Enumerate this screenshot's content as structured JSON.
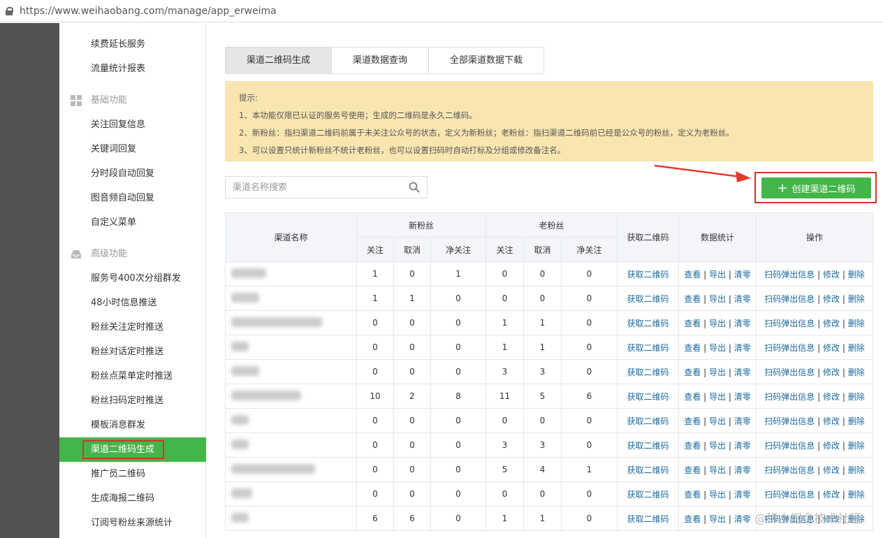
{
  "url": "https://www.weihaobang.com/manage/app_erweima",
  "sidebar": {
    "top_items": [
      "续费延长服务",
      "流量统计报表"
    ],
    "section_basic": "基础功能",
    "basic_items": [
      "关注回复信息",
      "关键词回复",
      "分时段自动回复",
      "图音频自动回复",
      "自定义菜单"
    ],
    "section_advanced": "高级功能",
    "advanced_items": [
      "服务号400次分组群发",
      "48小时信息推送",
      "粉丝关注定时推送",
      "粉丝对话定时推送",
      "粉丝点菜单定时推送",
      "粉丝扫码定时推送",
      "模板消息群发",
      "渠道二维码生成",
      "推广员二维码",
      "生成海报二维码",
      "订阅号粉丝来源统计"
    ],
    "active": "渠道二维码生成"
  },
  "tabs": [
    "渠道二维码生成",
    "渠道数据查询",
    "全部渠道数据下载"
  ],
  "notice": {
    "title": "提示:",
    "lines": [
      "1、本功能仅限已认证的服务号使用；生成的二维码是永久二维码。",
      "2、新粉丝：指扫渠道二维码前属于未关注公众号的状态，定义为新粉丝；老粉丝：指扫渠道二维码前已经是公众号的粉丝，定义为老粉丝。",
      "3、可以设置只统计新粉丝不统计老粉丝，也可以设置扫码时自动打标及分组或修改备注名。"
    ]
  },
  "search": {
    "placeholder": "渠道名称搜索"
  },
  "create_button": "创建渠道二维码",
  "table": {
    "headers": {
      "name": "渠道名称",
      "new": "新粉丝",
      "old": "老粉丝",
      "get_qr": "获取二维码",
      "stats": "数据统计",
      "ops": "操作",
      "follow": "关注",
      "cancel": "取消",
      "net": "净关注"
    },
    "links": {
      "get_qr": "获取二维码",
      "view": "查看",
      "export": "导出",
      "clear": "清零",
      "popup": "扫码弹出信息",
      "edit": "修改",
      "delete": "删除",
      "sep": "|"
    },
    "rows": [
      [
        1,
        0,
        1,
        0,
        0,
        0
      ],
      [
        1,
        1,
        0,
        0,
        0,
        0
      ],
      [
        0,
        0,
        0,
        1,
        1,
        0
      ],
      [
        0,
        0,
        0,
        1,
        1,
        0
      ],
      [
        0,
        0,
        0,
        3,
        3,
        0
      ],
      [
        10,
        2,
        8,
        11,
        5,
        6
      ],
      [
        0,
        0,
        0,
        0,
        0,
        0
      ],
      [
        0,
        0,
        0,
        3,
        3,
        0
      ],
      [
        0,
        0,
        0,
        5,
        4,
        1
      ],
      [
        0,
        0,
        0,
        0,
        0,
        0
      ],
      [
        6,
        6,
        0,
        1,
        1,
        0
      ]
    ]
  },
  "watermark": "@稀土掘金技术社区",
  "colors": {
    "green": "#44b549",
    "red": "#d0352b",
    "link": "#1b6a9c",
    "notice": "#f8e5b0"
  }
}
